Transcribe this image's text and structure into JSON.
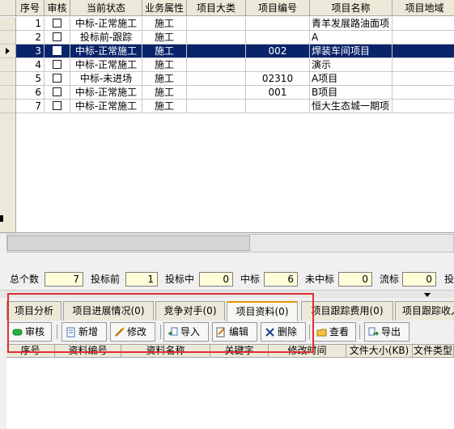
{
  "grid": {
    "headers": [
      "序号",
      "审核",
      "当前状态",
      "业务属性",
      "项目大类",
      "项目编号",
      "项目名称",
      "项目地域"
    ],
    "rows": [
      {
        "seq": "1",
        "status": "中标-正常施工",
        "biz": "施工",
        "category": "",
        "number": "",
        "name": "青羊发展路油面项",
        "region": ""
      },
      {
        "seq": "2",
        "status": "投标前-跟踪",
        "biz": "施工",
        "category": "",
        "number": "",
        "name": "A",
        "region": ""
      },
      {
        "seq": "3",
        "status": "中标-正常施工",
        "biz": "施工",
        "category": "",
        "number": "002",
        "name": "焊装车间项目",
        "region": ""
      },
      {
        "seq": "4",
        "status": "中标-正常施工",
        "biz": "施工",
        "category": "",
        "number": "",
        "name": "演示",
        "region": ""
      },
      {
        "seq": "5",
        "status": "中标-未进场",
        "biz": "施工",
        "category": "",
        "number": "02310",
        "name": "A项目",
        "region": ""
      },
      {
        "seq": "6",
        "status": "中标-正常施工",
        "biz": "施工",
        "category": "",
        "number": "001",
        "name": "B项目",
        "region": ""
      },
      {
        "seq": "7",
        "status": "中标-正常施工",
        "biz": "施工",
        "category": "",
        "number": "",
        "name": "恒大生态城一期项",
        "region": ""
      }
    ]
  },
  "stats": {
    "total_label": "总个数",
    "total": "7",
    "pre_bid_label": "投标前",
    "pre_bid": "1",
    "bidding_label": "投标中",
    "bidding": "0",
    "won_label": "中标",
    "won": "6",
    "lost_label": "未中标",
    "lost": "0",
    "abortive_label": "流标",
    "abortive": "0",
    "truncated_label": "投"
  },
  "tabs": [
    "项目分析",
    "项目进展情况(0)",
    "竞争对手(0)",
    "项目资料(0)",
    "项目跟踪费用(0)",
    "项目跟踪收入"
  ],
  "active_tab": "项目资料(0)",
  "toolbar": {
    "approve": "审核",
    "add": "新增",
    "edit": "修改",
    "import": "导入",
    "editor": "编辑",
    "delete": "删除",
    "view": "查看",
    "export": "导出"
  },
  "files_grid": {
    "headers": [
      "序号",
      "资料编号",
      "资料名称",
      "关键字",
      "修改时间",
      "文件大小(KB)",
      "文件类型"
    ]
  },
  "colors": {
    "selected_row": "#0a246a",
    "highlight": "#e03030",
    "active_tab_accent": "#e59700",
    "stat_box": "#fffed9"
  }
}
